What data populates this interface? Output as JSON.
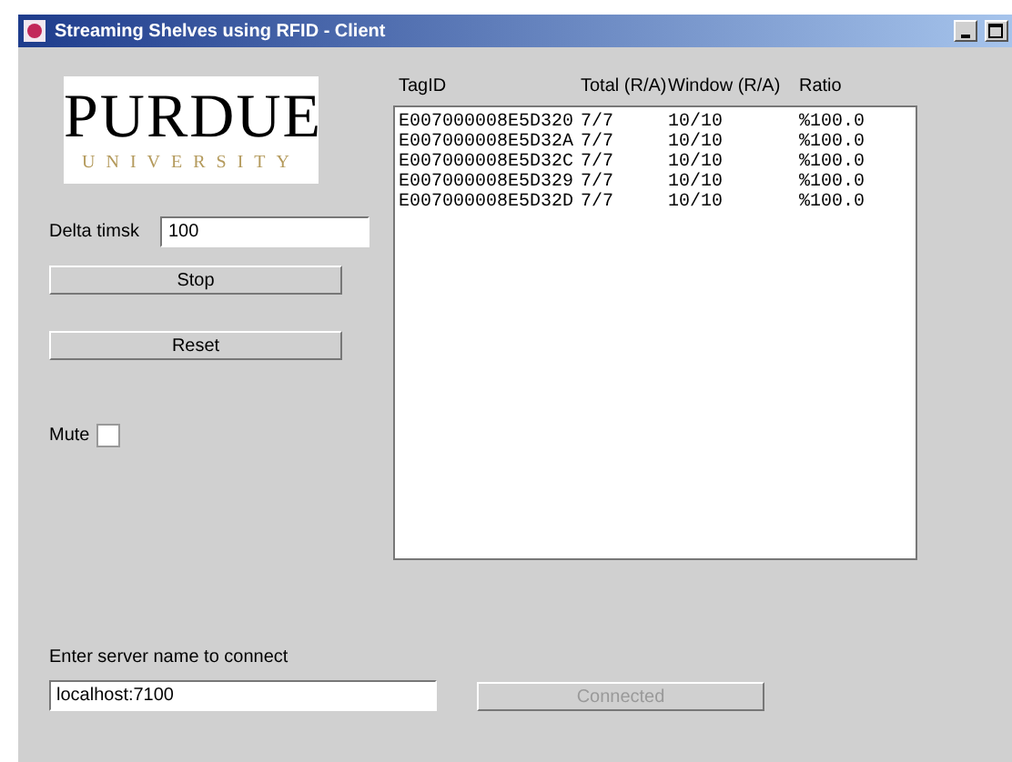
{
  "window": {
    "title": "Streaming Shelves using RFID - Client"
  },
  "logo": {
    "name": "PURDUE",
    "subtitle": "UNIVERSITY"
  },
  "delta": {
    "label": "Delta timsk",
    "value": "100"
  },
  "buttons": [
    {
      "label": "Stop",
      "disabled": false
    },
    {
      "label": "Reset",
      "disabled": false
    }
  ],
  "mute": {
    "label": "Mute",
    "checked": false
  },
  "table": {
    "columns": [
      "TagID",
      "Total (R/A)",
      "Window (R/A)",
      "Ratio"
    ],
    "rows": [
      [
        "E007000008E5D320",
        "7/7",
        "10/10",
        "%100.0"
      ],
      [
        "E007000008E5D32A",
        "7/7",
        "10/10",
        "%100.0"
      ],
      [
        "E007000008E5D32C",
        "7/7",
        "10/10",
        "%100.0"
      ],
      [
        "E007000008E5D329",
        "7/7",
        "10/10",
        "%100.0"
      ],
      [
        "E007000008E5D32D",
        "7/7",
        "10/10",
        "%100.0"
      ]
    ]
  },
  "server": {
    "label": "Enter server name to connect",
    "value": "localhost:7100",
    "button": {
      "label": "Connected",
      "disabled": true
    }
  }
}
